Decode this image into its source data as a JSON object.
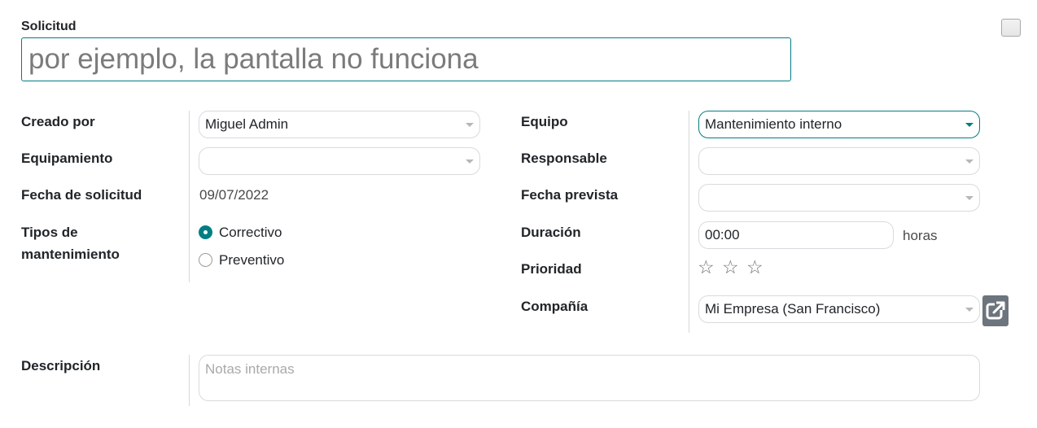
{
  "header": {
    "title_label": "Solicitud",
    "title_placeholder": "por ejemplo, la pantalla no funciona"
  },
  "left_fields": {
    "created_by_label": "Creado por",
    "created_by_value": "Miguel Admin",
    "equipment_label": "Equipamiento",
    "equipment_value": "",
    "request_date_label": "Fecha de solicitud",
    "request_date_value": "09/07/2022",
    "maintenance_type_label_1": "Tipos de",
    "maintenance_type_label_2": "mantenimiento",
    "maintenance_options": [
      "Correctivo",
      "Preventivo"
    ],
    "maintenance_selected": "Correctivo"
  },
  "right_fields": {
    "team_label": "Equipo",
    "team_value": "Mantenimiento interno",
    "responsible_label": "Responsable",
    "responsible_value": "",
    "scheduled_date_label": "Fecha prevista",
    "scheduled_date_value": "",
    "duration_label": "Duración",
    "duration_value": "00:00",
    "duration_unit": "horas",
    "priority_label": "Prioridad",
    "priority_value": 0,
    "priority_max": 3,
    "company_label": "Compañía",
    "company_value": "Mi Empresa (San Francisco)"
  },
  "description": {
    "label": "Descripción",
    "placeholder": "Notas internas"
  },
  "colors": {
    "accent": "#017e84",
    "external_button": "#6c757d"
  }
}
